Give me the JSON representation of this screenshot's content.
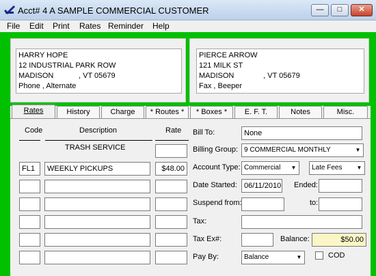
{
  "window": {
    "title": "Acct#  4 A SAMPLE COMMERCIAL CUSTOMER"
  },
  "menu": [
    "File",
    "Edit",
    "Print",
    "Rates",
    "Reminder",
    "Help"
  ],
  "bill_address": [
    "HARRY HOPE",
    "12 INDUSTRIAL PARK ROW",
    "MADISON            , VT 05679",
    "Phone , Alternate"
  ],
  "service_address": [
    "PIERCE ARROW",
    "121 MILK ST",
    "MADISON              , VT 05679",
    "Fax , Beeper"
  ],
  "tabs": [
    "Rates",
    "History",
    "Charge",
    "* Routes *",
    "* Boxes *",
    "E. F. T.",
    "Notes",
    "Misc."
  ],
  "rates": {
    "headers": {
      "code": "Code",
      "description": "Description",
      "rate": "Rate"
    },
    "group_label": "TRASH SERVICE",
    "rows": [
      {
        "code": "FL1",
        "description": "WEEKLY PICKUPS",
        "rate": "$48.00"
      },
      {
        "code": "",
        "description": "",
        "rate": ""
      },
      {
        "code": "",
        "description": "",
        "rate": ""
      },
      {
        "code": "",
        "description": "",
        "rate": ""
      },
      {
        "code": "",
        "description": "",
        "rate": ""
      },
      {
        "code": "",
        "description": "",
        "rate": ""
      }
    ]
  },
  "account": {
    "bill_to_label": "Bill To:",
    "bill_to": "None",
    "billing_group_label": "Billing Group:",
    "billing_group": "9  COMMERCIAL MONTHLY",
    "account_type_label": "Account Type:",
    "account_type": "Commercial",
    "late_fees": "Late Fees",
    "date_started_label": "Date Started:",
    "date_started": "06/11/2010",
    "ended_label": "Ended:",
    "ended": "",
    "suspend_from_label": "Suspend from:",
    "suspend_from": "",
    "to_label": "to:",
    "suspend_to": "",
    "tax_label": "Tax:",
    "tax": "",
    "tax_exempt_label": "Tax Ex#:",
    "tax_exempt": "",
    "balance_label": "Balance:",
    "balance": "$50.00",
    "pay_by_label": "Pay By:",
    "pay_by": "Balance",
    "cod_label": "COD"
  },
  "colors": {
    "background": "#00c000",
    "panel": "#f0f0f0",
    "balance_field": "#fbf6c6"
  }
}
